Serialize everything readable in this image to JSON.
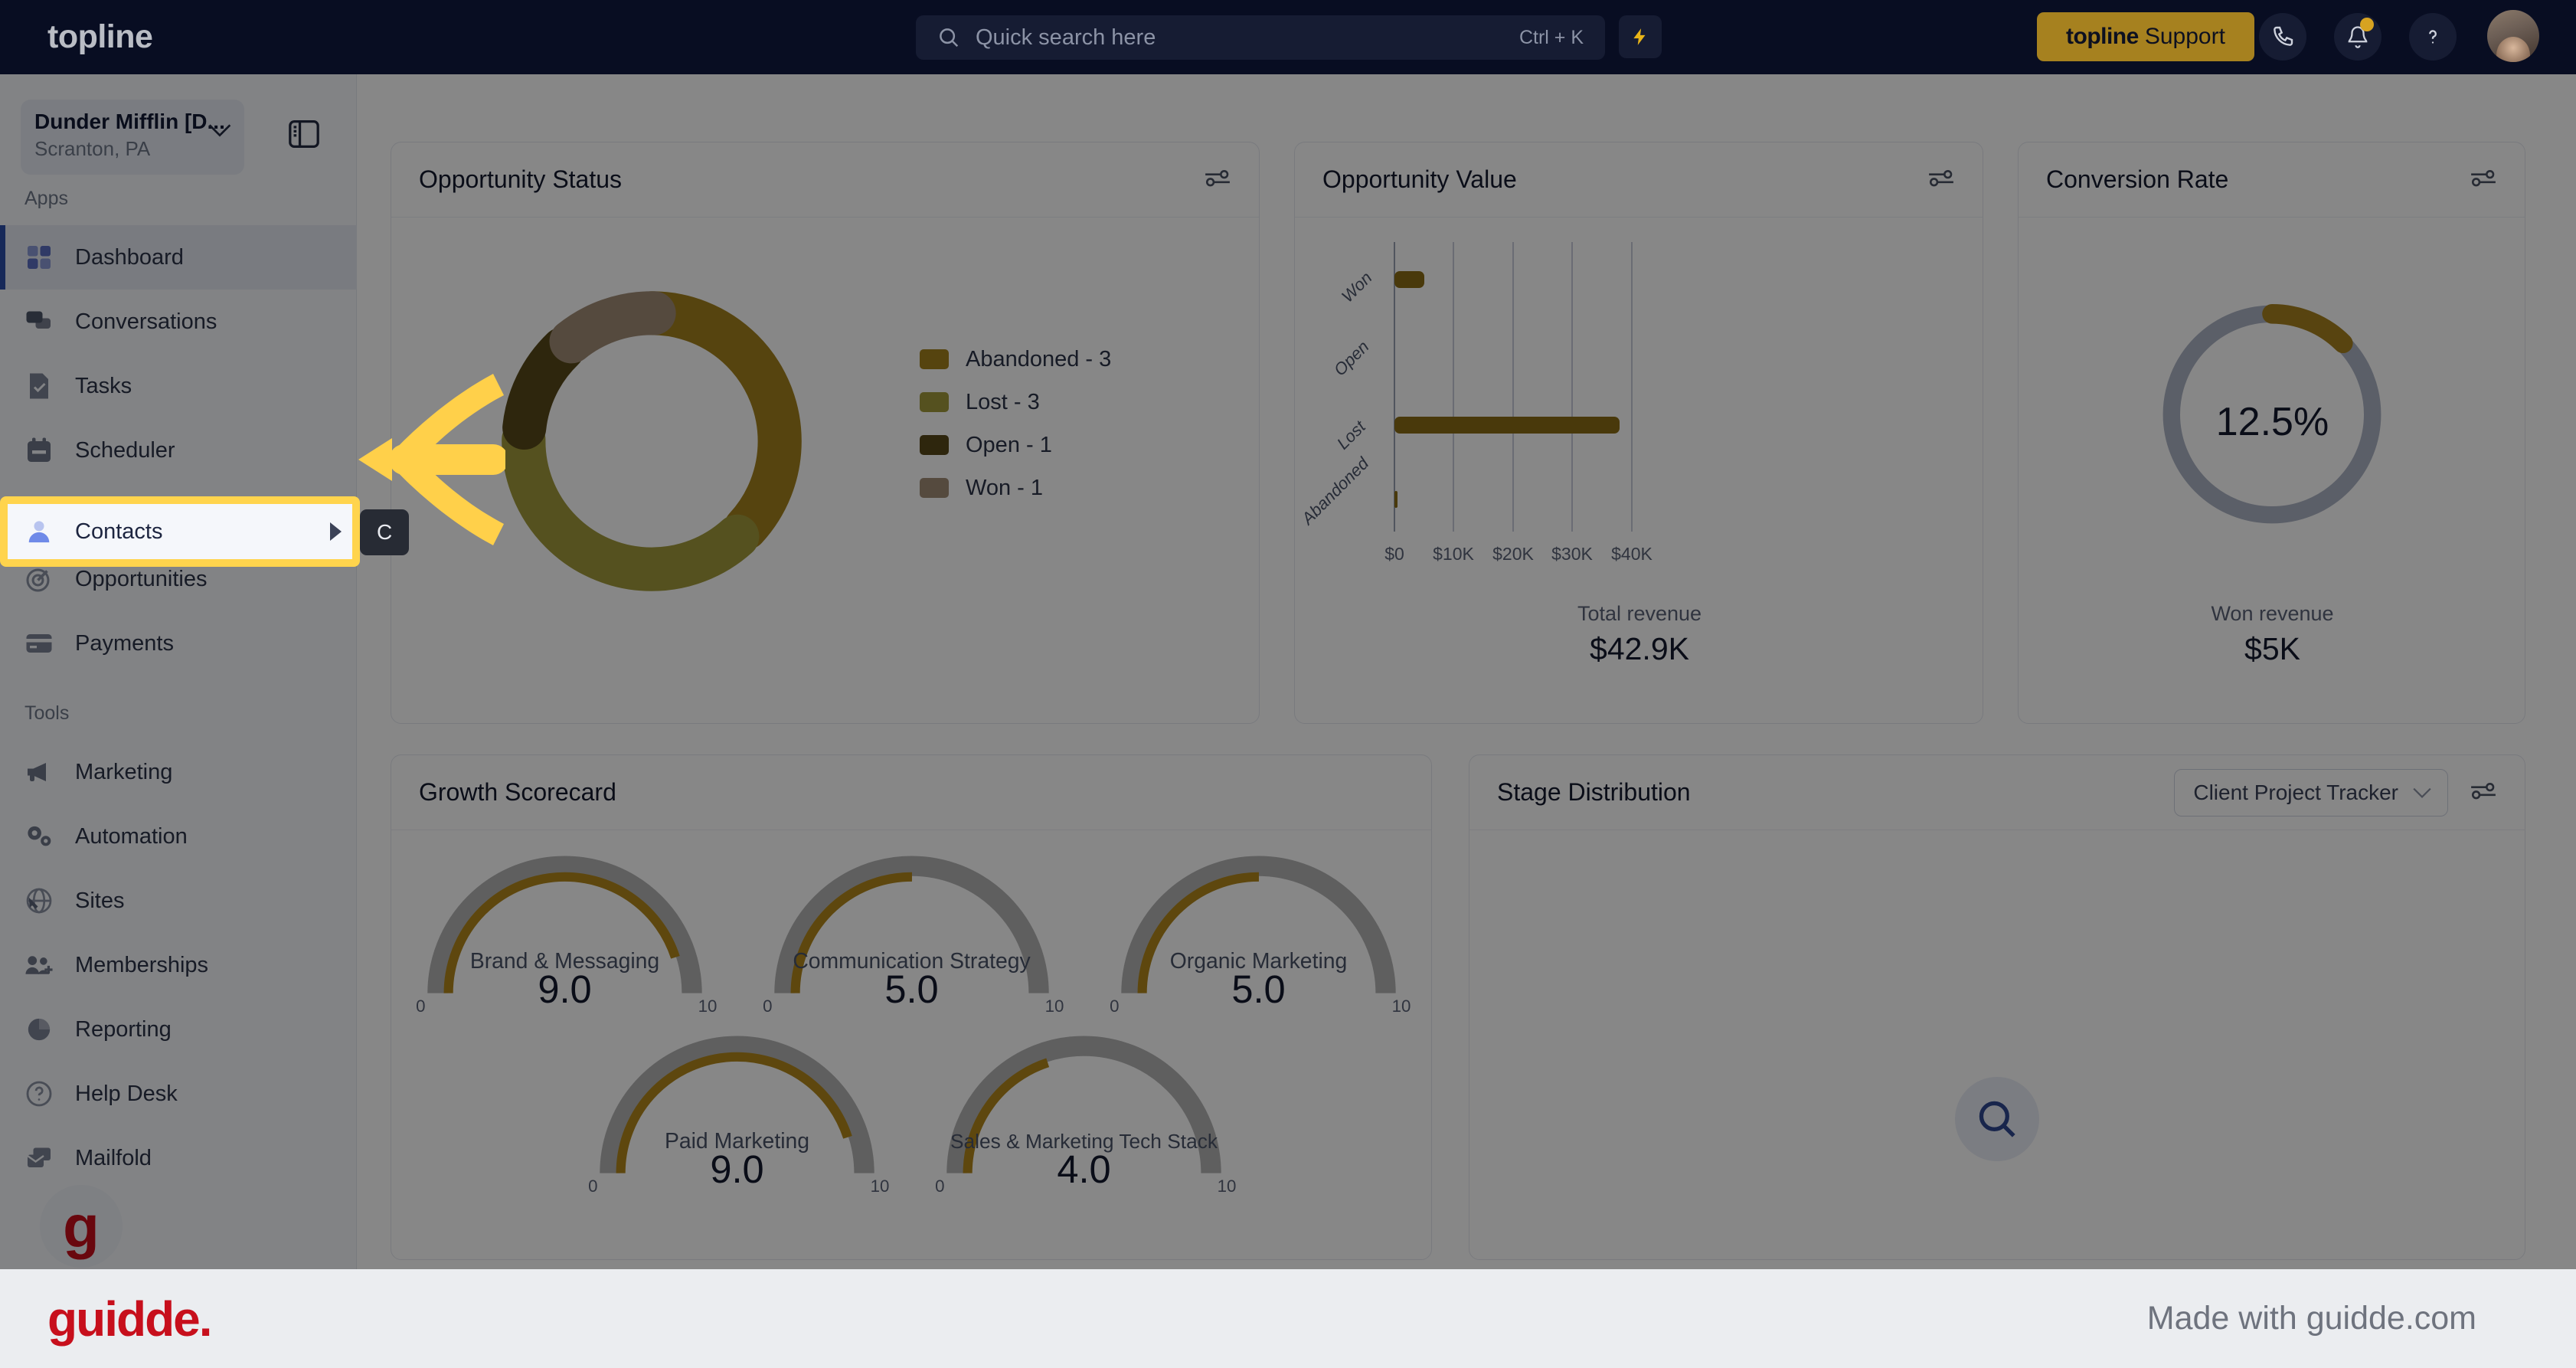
{
  "topbar": {
    "brand": "topline",
    "search": {
      "placeholder": "Quick search here",
      "shortcut": "Ctrl + K",
      "icon": "search-icon"
    },
    "bolt_icon": "lightning-bolt-icon",
    "support_button": {
      "brand": "topline",
      "label": "Support"
    },
    "phone_icon": "phone-icon",
    "bell_icon": "bell-icon",
    "help_icon": "question-mark-icon",
    "avatar": "user-avatar"
  },
  "sidebar": {
    "org": {
      "name": "Dunder Mifflin [D...",
      "location": "Scranton, PA",
      "chevron": "chevron-down-icon"
    },
    "panel_toggle_icon": "panel-toggle-icon",
    "sections": [
      {
        "label": "Apps",
        "items": [
          {
            "label": "Dashboard",
            "icon": "dashboard-icon",
            "active": true
          },
          {
            "label": "Conversations",
            "icon": "chat-bubbles-icon",
            "active": false
          },
          {
            "label": "Tasks",
            "icon": "task-document-icon",
            "active": false
          },
          {
            "label": "Scheduler",
            "icon": "calendar-icon",
            "active": false
          },
          {
            "label": "Contacts",
            "icon": "person-icon",
            "active": false
          },
          {
            "label": "Opportunities",
            "icon": "target-icon",
            "active": false
          },
          {
            "label": "Payments",
            "icon": "credit-card-icon",
            "active": false
          }
        ]
      },
      {
        "label": "Tools",
        "items": [
          {
            "label": "Marketing",
            "icon": "megaphone-icon",
            "active": false
          },
          {
            "label": "Automation",
            "icon": "gears-icon",
            "active": false
          },
          {
            "label": "Sites",
            "icon": "globe-cursor-icon",
            "active": false
          },
          {
            "label": "Memberships",
            "icon": "people-add-icon",
            "active": false
          },
          {
            "label": "Reporting",
            "icon": "pie-chart-icon",
            "active": false
          },
          {
            "label": "Help Desk",
            "icon": "question-circle-icon",
            "active": false
          },
          {
            "label": "Mailfold",
            "icon": "mail-stack-icon",
            "active": false
          }
        ]
      }
    ]
  },
  "highlight": {
    "item_label": "Contacts",
    "item_icon": "person-icon",
    "expand_icon": "caret-right-icon",
    "tooltip_text": "C",
    "arrow_icon": "left-arrow-pointer",
    "border_color": "#ffd44d"
  },
  "cards": {
    "opportunity_status": {
      "title": "Opportunity Status",
      "settings_icon": "sliders-icon"
    },
    "opportunity_value": {
      "title": "Opportunity Value",
      "settings_icon": "sliders-icon",
      "total_label": "Total revenue",
      "total_value": "$42.9K"
    },
    "conversion_rate": {
      "title": "Conversion Rate",
      "settings_icon": "sliders-icon",
      "percent_label": "12.5%",
      "won_label": "Won revenue",
      "won_value": "$5K"
    },
    "growth_scorecard": {
      "title": "Growth Scorecard"
    },
    "stage_distribution": {
      "title": "Stage Distribution",
      "select_value": "Client Project Tracker",
      "select_chevron": "chevron-down-icon",
      "settings_icon": "sliders-icon",
      "empty_icon": "magnifier-icon"
    }
  },
  "chart_data": [
    {
      "type": "pie",
      "title": "Opportunity Status",
      "legend_position": "right",
      "categories": [
        "Abandoned",
        "Lost",
        "Open",
        "Won"
      ],
      "values": [
        3,
        3,
        1,
        1
      ],
      "labels": [
        "Abandoned - 3",
        "Lost - 3",
        "Open - 1",
        "Won - 1"
      ],
      "colors": [
        "#a2801d",
        "#a19a3b",
        "#574919",
        "#a08c76"
      ]
    },
    {
      "type": "bar",
      "title": "Opportunity Value",
      "orientation": "horizontal",
      "categories": [
        "Won",
        "Open",
        "Lost",
        "Abandoned"
      ],
      "values": [
        5000,
        0,
        37900,
        300
      ],
      "xlabel": "",
      "ylabel": "",
      "xlim": [
        0,
        43000
      ],
      "xticks": [
        "$0",
        "$10K",
        "$20K",
        "$30K",
        "$40K"
      ],
      "grid": true,
      "color": "#8a6d15"
    },
    {
      "type": "pie",
      "subtype": "donut-progress",
      "title": "Conversion Rate",
      "values": [
        12.5,
        87.5
      ],
      "value_label": "12.5%",
      "colors": [
        "#a6811f",
        "#adb3c4"
      ]
    },
    {
      "type": "bar",
      "subtype": "gauges",
      "title": "Growth Scorecard",
      "categories": [
        "Brand & Messaging",
        "Communication Strategy",
        "Organic Marketing",
        "Paid Marketing",
        "Sales & Marketing Tech Stack"
      ],
      "values": [
        9.0,
        5.0,
        5.0,
        9.0,
        4.0
      ],
      "value_labels": [
        "9.0",
        "5.0",
        "5.0",
        "9.0",
        "4.0"
      ],
      "ylim": [
        0,
        10
      ],
      "min_tick": "0",
      "max_tick": "10",
      "color": "#b2871c",
      "track_color": "#b4b4b4"
    }
  ],
  "footer": {
    "logo": "guidde.",
    "tagline": "Made with guidde.com"
  }
}
